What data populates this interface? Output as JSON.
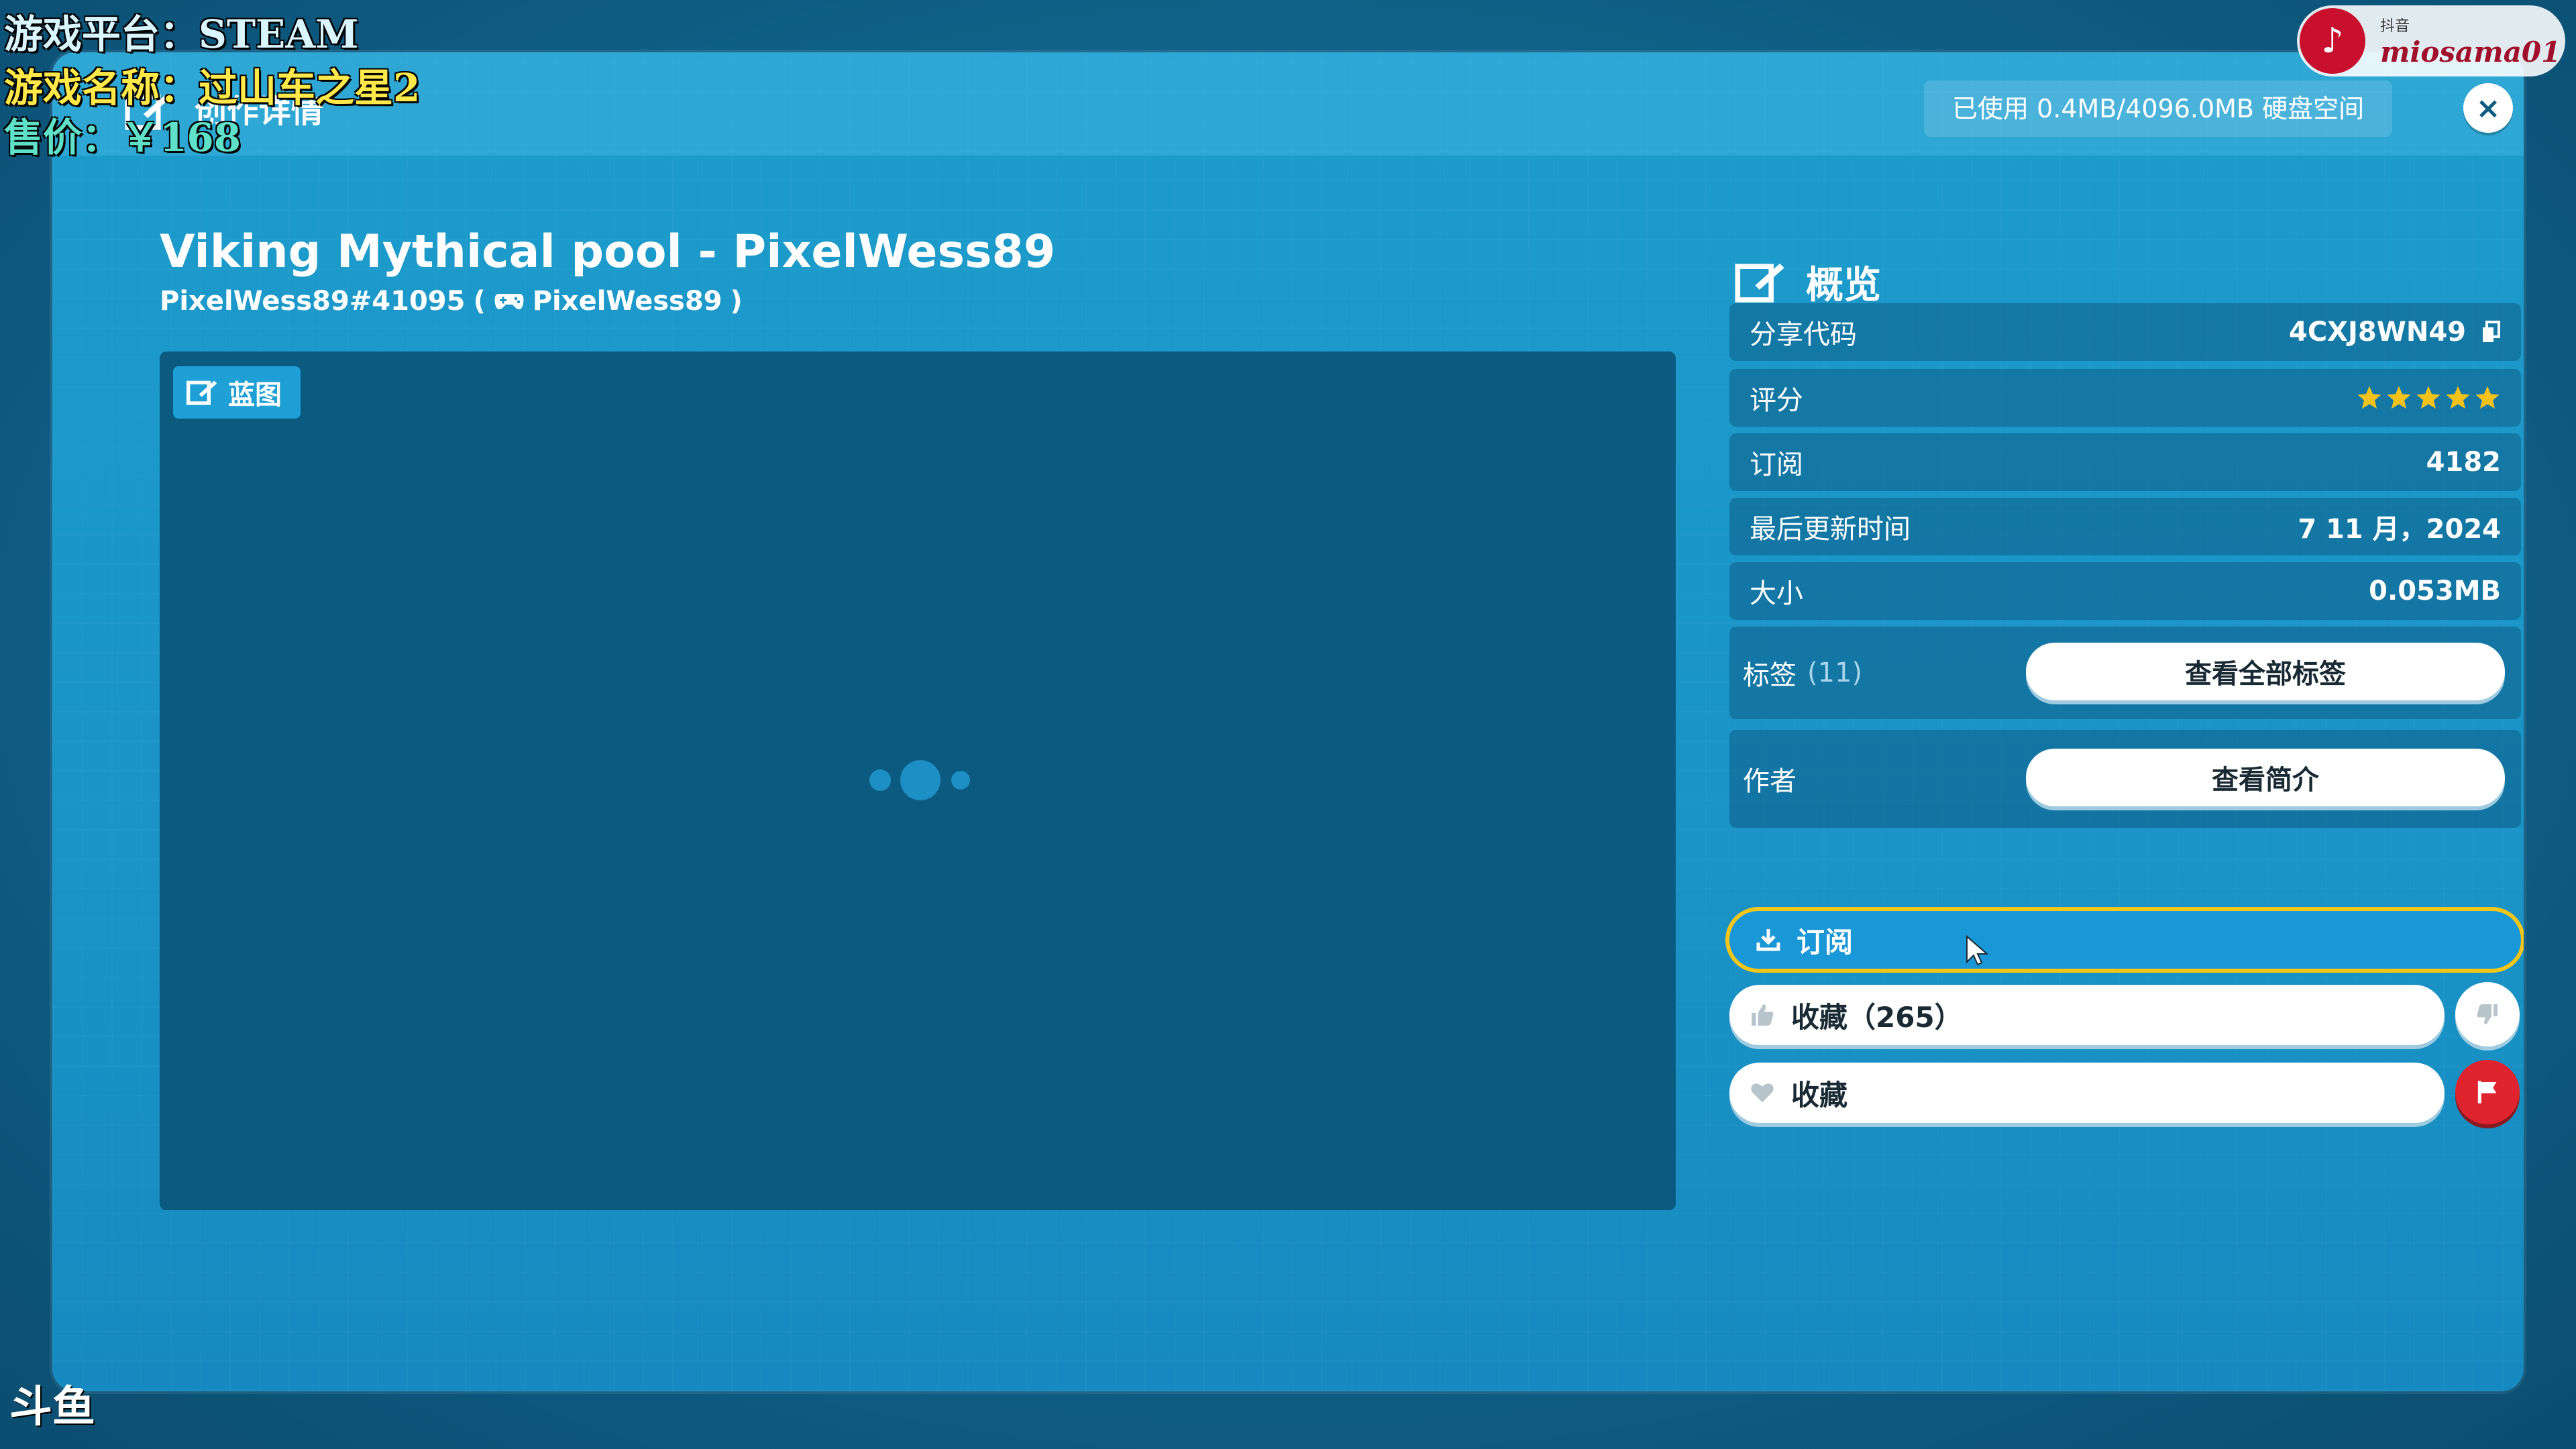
{
  "header": {
    "title": "创作详情",
    "disk_usage": "已使用 0.4MB/4096.0MB 硬盘空间",
    "close_label": "×"
  },
  "creation": {
    "title": "Viking Mythical pool - PixelWess89",
    "id": "PixelWess89#41095",
    "paren_open": "(",
    "platform_user": "PixelWess89",
    "paren_close": ")"
  },
  "preview": {
    "badge_label": "蓝图"
  },
  "overview": {
    "heading": "概览",
    "share_code_label": "分享代码",
    "share_code": "4CXJ8WN49",
    "rating_label": "评分",
    "rating_stars": 5,
    "subscriptions_label": "订阅",
    "subscriptions": "4182",
    "updated_label": "最后更新时间",
    "updated": "7 11 月，2024",
    "size_label": "大小",
    "size": "0.053MB",
    "tags_label": "标签",
    "tags_count": "(11)",
    "view_tags_button": "查看全部标签",
    "author_label": "作者",
    "view_profile_button": "查看简介"
  },
  "actions": {
    "subscribe": "订阅",
    "like": "收藏（265）",
    "favorite": "收藏"
  },
  "colors": {
    "accent_yellow": "#f4c51a",
    "report_red": "#e0242f",
    "star_gold": "#f5c21a"
  },
  "stream_overlay": {
    "platform": "游戏平台：STEAM",
    "game": "游戏名称：过山车之星2",
    "price": "售价：￥168",
    "douyin_label": "抖音",
    "douyin_handle": "miosama01",
    "douyu_logo": "斗鱼"
  }
}
